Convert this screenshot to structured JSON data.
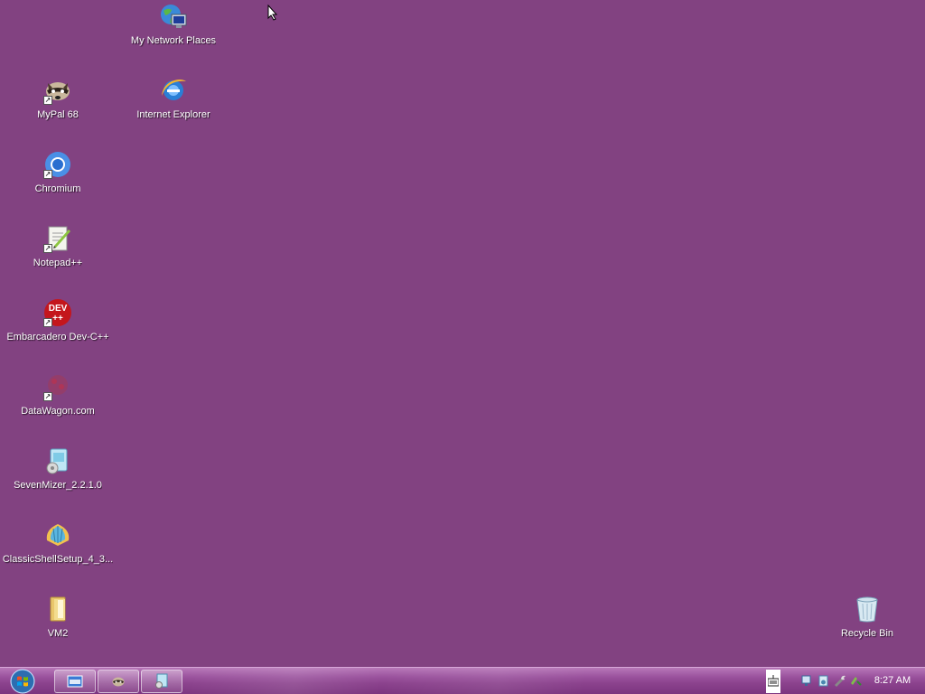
{
  "desktop": {
    "background_color": "#824281",
    "icons": [
      {
        "label": "My Network Places",
        "icon": "network-places-icon"
      },
      {
        "label": "MyPal 68",
        "icon": "mypal-raccoon-icon"
      },
      {
        "label": "Internet Explorer",
        "icon": "internet-explorer-icon"
      },
      {
        "label": "Chromium",
        "icon": "chromium-icon"
      },
      {
        "label": "Notepad++",
        "icon": "notepad-plus-plus-icon"
      },
      {
        "label": "Embarcadero Dev-C++",
        "icon": "dev-cpp-icon",
        "badge_text": "DEV\n++"
      },
      {
        "label": "DataWagon.com",
        "icon": "datawagon-icon"
      },
      {
        "label": "SevenMizer_2.2.1.0",
        "icon": "sevenmizer-installer-icon"
      },
      {
        "label": "ClassicShellSetup_4_3...",
        "icon": "classic-shell-icon"
      },
      {
        "label": "VM2",
        "icon": "folder-icon"
      },
      {
        "label": "Recycle Bin",
        "icon": "recycle-bin-icon"
      }
    ]
  },
  "taskbar": {
    "start_icon": "windows-start-orb-icon",
    "buttons": [
      {
        "icon": "keyboard-window-icon"
      },
      {
        "icon": "mypal-raccoon-icon"
      },
      {
        "icon": "installer-window-icon"
      }
    ],
    "tray": {
      "icons": [
        "on-screen-keyboard-icon",
        "network-icon",
        "volume-icon",
        "tool-icon",
        "safe-remove-icon"
      ],
      "clock": "8:27 AM"
    }
  }
}
